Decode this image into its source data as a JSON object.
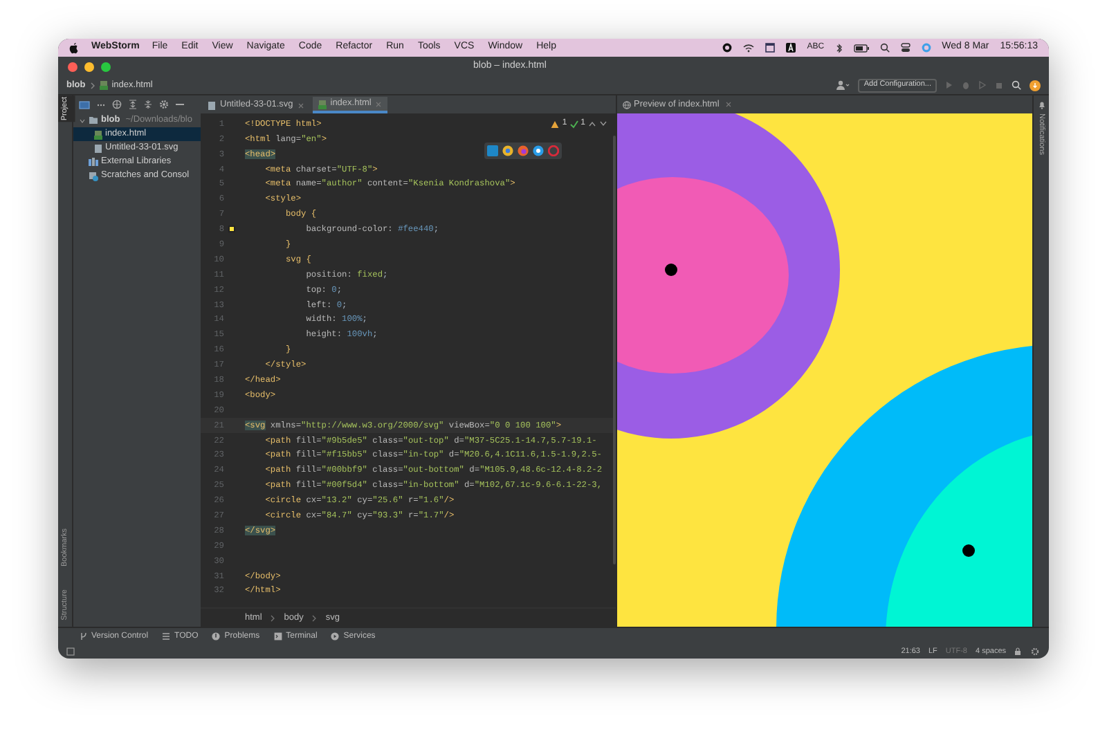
{
  "menubar": {
    "app": "WebStorm",
    "items": [
      "File",
      "Edit",
      "View",
      "Navigate",
      "Code",
      "Refactor",
      "Run",
      "Tools",
      "VCS",
      "Window",
      "Help"
    ],
    "input_source": "ABC",
    "date": "Wed 8 Mar",
    "time": "15:56:13"
  },
  "window": {
    "title": "blob – index.html"
  },
  "navbar": {
    "breadcrumbs": [
      "blob",
      "index.html"
    ],
    "run_config": "Add Configuration..."
  },
  "left_strip": [
    {
      "label": "Project",
      "selected": true
    },
    {
      "label": "Bookmarks",
      "selected": false
    },
    {
      "label": "Structure",
      "selected": false
    }
  ],
  "right_strip": {
    "label": "Notifications"
  },
  "project": {
    "tree": [
      {
        "label": "blob",
        "path": "~/Downloads/blo",
        "kind": "folder",
        "selected": false,
        "expanded": true,
        "children": [
          {
            "label": "index.html",
            "kind": "html",
            "selected": true
          },
          {
            "label": "Untitled-33-01.svg",
            "kind": "svg",
            "selected": false
          }
        ]
      },
      {
        "label": "External Libraries",
        "kind": "library",
        "selected": false
      },
      {
        "label": "Scratches and Consol",
        "kind": "scratch",
        "selected": false
      }
    ]
  },
  "editor": {
    "tabs": [
      {
        "label": "Untitled-33-01.svg",
        "kind": "svg",
        "selected": false
      },
      {
        "label": "index.html",
        "kind": "html",
        "selected": true
      }
    ],
    "inspections": {
      "warnings": "1",
      "passed": "1"
    },
    "lines": [
      {
        "number": "1",
        "segments": [
          {
            "kind": "tag",
            "text": "<!DOCTYPE html>"
          }
        ]
      },
      {
        "number": "2",
        "segments": [
          {
            "kind": "tag",
            "text": "<html "
          },
          {
            "kind": "attr",
            "text": "lang="
          },
          {
            "kind": "str",
            "text": "\"en\""
          },
          {
            "kind": "tag",
            "text": ">"
          }
        ]
      },
      {
        "number": "3",
        "segments": [
          {
            "kind": "tag",
            "text": "<head>",
            "matched": true
          }
        ]
      },
      {
        "number": "4",
        "segments": [
          {
            "kind": "tag",
            "text": "    <meta "
          },
          {
            "kind": "attr",
            "text": "charset="
          },
          {
            "kind": "str",
            "text": "\"UTF-8\""
          },
          {
            "kind": "tag",
            "text": ">"
          }
        ]
      },
      {
        "number": "5",
        "segments": [
          {
            "kind": "tag",
            "text": "    <meta "
          },
          {
            "kind": "attr",
            "text": "name="
          },
          {
            "kind": "str",
            "text": "\"author\""
          },
          {
            "kind": "attr",
            "text": " content="
          },
          {
            "kind": "str",
            "text": "\"Ksenia Kondrashova\""
          },
          {
            "kind": "tag",
            "text": ">"
          }
        ]
      },
      {
        "number": "6",
        "segments": [
          {
            "kind": "tag",
            "text": "    <style>"
          }
        ]
      },
      {
        "number": "7",
        "segments": [
          {
            "kind": "tag",
            "text": "        body {"
          }
        ]
      },
      {
        "number": "8",
        "swatch": true,
        "segments": [
          {
            "kind": "attr",
            "text": "            background-color: "
          },
          {
            "kind": "num",
            "text": "#fee440"
          },
          {
            "kind": "plain",
            "text": ";"
          }
        ]
      },
      {
        "number": "9",
        "segments": [
          {
            "kind": "tag",
            "text": "        }"
          }
        ]
      },
      {
        "number": "10",
        "segments": [
          {
            "kind": "tag",
            "text": "        svg {"
          }
        ]
      },
      {
        "number": "11",
        "segments": [
          {
            "kind": "attr",
            "text": "            position: "
          },
          {
            "kind": "str",
            "text": "fixed"
          },
          {
            "kind": "plain",
            "text": ";"
          }
        ]
      },
      {
        "number": "12",
        "segments": [
          {
            "kind": "attr",
            "text": "            top: "
          },
          {
            "kind": "num",
            "text": "0"
          },
          {
            "kind": "plain",
            "text": ";"
          }
        ]
      },
      {
        "number": "13",
        "segments": [
          {
            "kind": "attr",
            "text": "            left: "
          },
          {
            "kind": "num",
            "text": "0"
          },
          {
            "kind": "plain",
            "text": ";"
          }
        ]
      },
      {
        "number": "14",
        "segments": [
          {
            "kind": "attr",
            "text": "            width: "
          },
          {
            "kind": "num",
            "text": "100%"
          },
          {
            "kind": "plain",
            "text": ";"
          }
        ]
      },
      {
        "number": "15",
        "segments": [
          {
            "kind": "attr",
            "text": "            height: "
          },
          {
            "kind": "num",
            "text": "100vh"
          },
          {
            "kind": "plain",
            "text": ";"
          }
        ]
      },
      {
        "number": "16",
        "segments": [
          {
            "kind": "tag",
            "text": "        }"
          }
        ]
      },
      {
        "number": "17",
        "segments": [
          {
            "kind": "tag",
            "text": "    </style>"
          }
        ]
      },
      {
        "number": "18",
        "segments": [
          {
            "kind": "tag",
            "text": "</head>"
          }
        ]
      },
      {
        "number": "19",
        "segments": [
          {
            "kind": "tag",
            "text": "<body>"
          }
        ]
      },
      {
        "number": "20"
      },
      {
        "number": "21",
        "current": true,
        "segments": [
          {
            "kind": "tag",
            "text": "<svg",
            "matched": true
          },
          {
            "kind": "attr",
            "text": " xmlns="
          },
          {
            "kind": "str",
            "text": "\"http://www.w3.org/2000/svg\""
          },
          {
            "kind": "attr",
            "text": " viewBox="
          },
          {
            "kind": "str",
            "text": "\"0 0 100 100\""
          },
          {
            "kind": "tag",
            "text": ">"
          }
        ]
      },
      {
        "number": "22",
        "segments": [
          {
            "kind": "tag",
            "text": "    <path "
          },
          {
            "kind": "attr",
            "text": "fill="
          },
          {
            "kind": "str",
            "text": "\"#9b5de5\""
          },
          {
            "kind": "attr",
            "text": " class="
          },
          {
            "kind": "str",
            "text": "\"out-top\""
          },
          {
            "kind": "attr",
            "text": " d="
          },
          {
            "kind": "str",
            "text": "\"M37-5C25.1-14.7,5.7-19.1-"
          }
        ]
      },
      {
        "number": "23",
        "segments": [
          {
            "kind": "tag",
            "text": "    <path "
          },
          {
            "kind": "attr",
            "text": "fill="
          },
          {
            "kind": "str",
            "text": "\"#f15bb5\""
          },
          {
            "kind": "attr",
            "text": " class="
          },
          {
            "kind": "str",
            "text": "\"in-top\""
          },
          {
            "kind": "attr",
            "text": " d="
          },
          {
            "kind": "str",
            "text": "\"M20.6,4.1C11.6,1.5-1.9,2.5-"
          }
        ]
      },
      {
        "number": "24",
        "segments": [
          {
            "kind": "tag",
            "text": "    <path "
          },
          {
            "kind": "attr",
            "text": "fill="
          },
          {
            "kind": "str",
            "text": "\"#00bbf9\""
          },
          {
            "kind": "attr",
            "text": " class="
          },
          {
            "kind": "str",
            "text": "\"out-bottom\""
          },
          {
            "kind": "attr",
            "text": " d="
          },
          {
            "kind": "str",
            "text": "\"M105.9,48.6c-12.4-8.2-2"
          }
        ]
      },
      {
        "number": "25",
        "segments": [
          {
            "kind": "tag",
            "text": "    <path "
          },
          {
            "kind": "attr",
            "text": "fill="
          },
          {
            "kind": "str",
            "text": "\"#00f5d4\""
          },
          {
            "kind": "attr",
            "text": " class="
          },
          {
            "kind": "str",
            "text": "\"in-bottom\""
          },
          {
            "kind": "attr",
            "text": " d="
          },
          {
            "kind": "str",
            "text": "\"M102,67.1c-9.6-6.1-22-3,"
          }
        ]
      },
      {
        "number": "26",
        "segments": [
          {
            "kind": "tag",
            "text": "    <circle "
          },
          {
            "kind": "attr",
            "text": "cx="
          },
          {
            "kind": "str",
            "text": "\"13.2\""
          },
          {
            "kind": "attr",
            "text": " cy="
          },
          {
            "kind": "str",
            "text": "\"25.6\""
          },
          {
            "kind": "attr",
            "text": " r="
          },
          {
            "kind": "str",
            "text": "\"1.6\""
          },
          {
            "kind": "tag",
            "text": "/>"
          }
        ]
      },
      {
        "number": "27",
        "segments": [
          {
            "kind": "tag",
            "text": "    <circle "
          },
          {
            "kind": "attr",
            "text": "cx="
          },
          {
            "kind": "str",
            "text": "\"84.7\""
          },
          {
            "kind": "attr",
            "text": " cy="
          },
          {
            "kind": "str",
            "text": "\"93.3\""
          },
          {
            "kind": "attr",
            "text": " r="
          },
          {
            "kind": "str",
            "text": "\"1.7\""
          },
          {
            "kind": "tag",
            "text": "/>"
          }
        ]
      },
      {
        "number": "28",
        "segments": [
          {
            "kind": "tag",
            "text": "</svg>",
            "matched": true
          }
        ]
      },
      {
        "number": "29"
      },
      {
        "number": "30"
      },
      {
        "number": "31",
        "segments": [
          {
            "kind": "tag",
            "text": "</body>"
          }
        ]
      },
      {
        "number": "32",
        "segments": [
          {
            "kind": "tag",
            "text": "</html>"
          }
        ]
      }
    ],
    "breadcrumbs": [
      "html",
      "body",
      "svg"
    ]
  },
  "preview": {
    "tab": "Preview of index.html"
  },
  "tool_windows": [
    "Version Control",
    "TODO",
    "Problems",
    "Terminal",
    "Services"
  ],
  "status_bar": {
    "position": "21:63",
    "line_separator": "LF",
    "encoding": "UTF-8",
    "indent": "4 spaces"
  }
}
